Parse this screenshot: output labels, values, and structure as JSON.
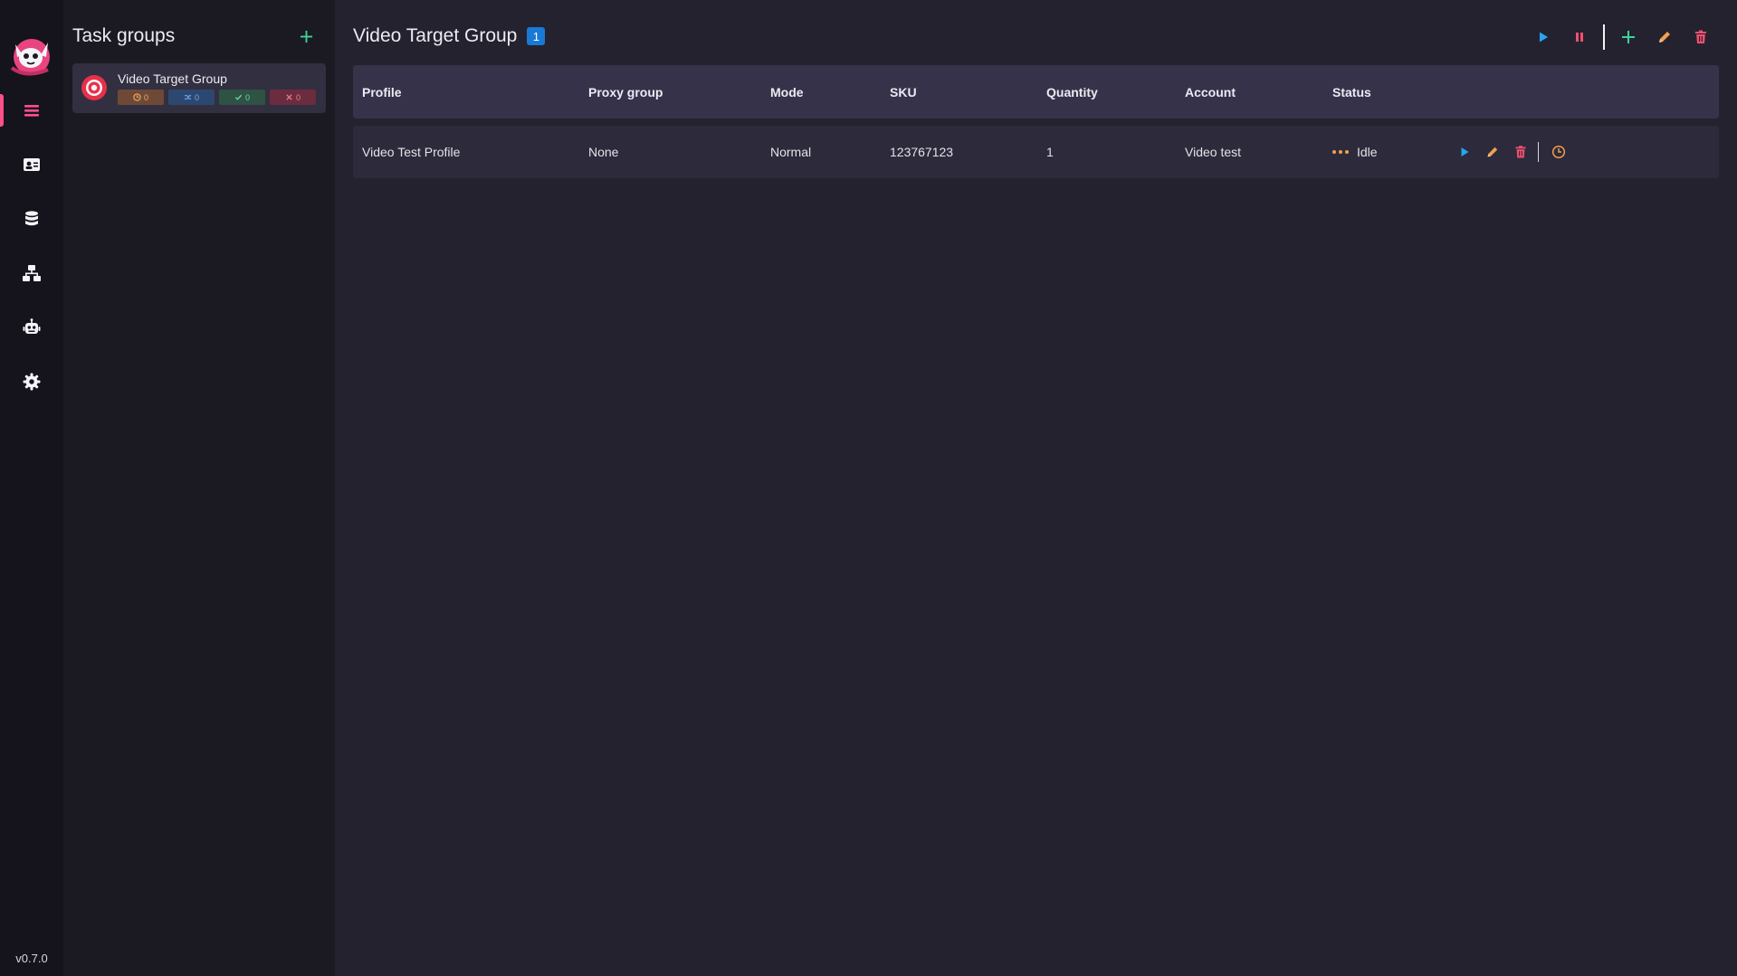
{
  "app": {
    "version": "v0.7.0"
  },
  "nav": {
    "items": [
      {
        "name": "tasks",
        "icon": "list-icon",
        "active": true
      },
      {
        "name": "profiles",
        "icon": "id-card-icon"
      },
      {
        "name": "database",
        "icon": "database-icon"
      },
      {
        "name": "proxies",
        "icon": "network-icon"
      },
      {
        "name": "accounts",
        "icon": "robot-icon"
      },
      {
        "name": "settings",
        "icon": "gear-icon"
      }
    ]
  },
  "groups": {
    "title": "Task groups",
    "items": [
      {
        "name": "Video Target Group",
        "badges": {
          "idle": "0",
          "running": "0",
          "success": "0",
          "failed": "0"
        }
      }
    ]
  },
  "main": {
    "title": "Video Target Group",
    "count": "1",
    "columns": [
      "Profile",
      "Proxy group",
      "Mode",
      "SKU",
      "Quantity",
      "Account",
      "Status"
    ],
    "rows": [
      {
        "profile": "Video Test Profile",
        "proxy_group": "None",
        "mode": "Normal",
        "sku": "123767123",
        "quantity": "1",
        "account": "Video test",
        "status": "Idle"
      }
    ]
  },
  "colors": {
    "accent_pink": "#ff4f8b",
    "play_blue": "#27a4f2",
    "pause_red": "#f0506e",
    "add_green": "#3fd39a",
    "edit_orange": "#f0a050",
    "delete_red": "#f0506e"
  }
}
